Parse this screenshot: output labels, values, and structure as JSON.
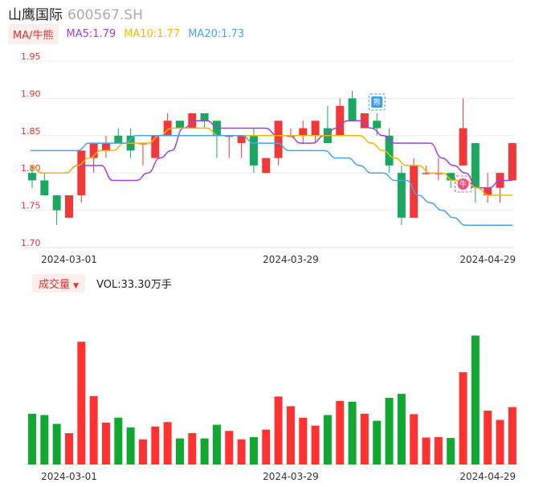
{
  "header": {
    "name": "山鹰国际",
    "code": "600567.SH"
  },
  "ma_legend": {
    "chip": "MA/牛熊",
    "items": [
      {
        "label": "MA5:1.79",
        "color": "#a040e0"
      },
      {
        "label": "MA10:1.77",
        "color": "#f2b800"
      },
      {
        "label": "MA20:1.73",
        "color": "#4aa3ea"
      }
    ]
  },
  "vol_legend": {
    "chip": "成交量",
    "label": "VOL:33.30万手"
  },
  "markers": {
    "bear": "熊",
    "bull": "牛"
  },
  "colors": {
    "up": "#f03838",
    "down": "#1aa860",
    "vol_up": "#ff3232",
    "vol_down": "#10a830",
    "ma5": "#a040e0",
    "ma10": "#f2b800",
    "ma20": "#4aa3ea"
  },
  "chart_data": [
    {
      "type": "candlestick",
      "y_ticks": [
        "1.95",
        "1.90",
        "1.85",
        "1.80",
        "1.75",
        "1.70"
      ],
      "ylim": [
        1.7,
        1.95
      ],
      "x_labels": [
        {
          "index": 0,
          "label": "2024-03-01"
        },
        {
          "index": 18,
          "label": "2024-03-29"
        },
        {
          "index": 34,
          "label": "2024-04-29"
        }
      ],
      "candles": [
        {
          "o": 1.8,
          "h": 1.81,
          "l": 1.78,
          "c": 1.79
        },
        {
          "o": 1.79,
          "h": 1.8,
          "l": 1.77,
          "c": 1.77
        },
        {
          "o": 1.77,
          "h": 1.77,
          "l": 1.73,
          "c": 1.75
        },
        {
          "o": 1.74,
          "h": 1.77,
          "l": 1.74,
          "c": 1.77
        },
        {
          "o": 1.77,
          "h": 1.83,
          "l": 1.76,
          "c": 1.83
        },
        {
          "o": 1.82,
          "h": 1.84,
          "l": 1.8,
          "c": 1.84
        },
        {
          "o": 1.83,
          "h": 1.85,
          "l": 1.82,
          "c": 1.84
        },
        {
          "o": 1.85,
          "h": 1.86,
          "l": 1.84,
          "c": 1.84
        },
        {
          "o": 1.85,
          "h": 1.86,
          "l": 1.82,
          "c": 1.83
        },
        {
          "o": 1.84,
          "h": 1.84,
          "l": 1.81,
          "c": 1.84
        },
        {
          "o": 1.82,
          "h": 1.85,
          "l": 1.82,
          "c": 1.85
        },
        {
          "o": 1.85,
          "h": 1.88,
          "l": 1.85,
          "c": 1.87
        },
        {
          "o": 1.87,
          "h": 1.87,
          "l": 1.86,
          "c": 1.86
        },
        {
          "o": 1.86,
          "h": 1.88,
          "l": 1.86,
          "c": 1.88
        },
        {
          "o": 1.88,
          "h": 1.88,
          "l": 1.86,
          "c": 1.87
        },
        {
          "o": 1.87,
          "h": 1.87,
          "l": 1.82,
          "c": 1.85
        },
        {
          "o": 1.85,
          "h": 1.85,
          "l": 1.82,
          "c": 1.85
        },
        {
          "o": 1.84,
          "h": 1.85,
          "l": 1.82,
          "c": 1.85
        },
        {
          "o": 1.85,
          "h": 1.86,
          "l": 1.8,
          "c": 1.81
        },
        {
          "o": 1.8,
          "h": 1.82,
          "l": 1.8,
          "c": 1.82
        },
        {
          "o": 1.82,
          "h": 1.87,
          "l": 1.81,
          "c": 1.87
        },
        {
          "o": 1.85,
          "h": 1.86,
          "l": 1.85,
          "c": 1.85
        },
        {
          "o": 1.85,
          "h": 1.87,
          "l": 1.84,
          "c": 1.86
        },
        {
          "o": 1.85,
          "h": 1.87,
          "l": 1.84,
          "c": 1.87
        },
        {
          "o": 1.86,
          "h": 1.89,
          "l": 1.84,
          "c": 1.84
        },
        {
          "o": 1.85,
          "h": 1.9,
          "l": 1.85,
          "c": 1.89
        },
        {
          "o": 1.9,
          "h": 1.91,
          "l": 1.87,
          "c": 1.87
        },
        {
          "o": 1.86,
          "h": 1.88,
          "l": 1.86,
          "c": 1.88
        },
        {
          "o": 1.87,
          "h": 1.88,
          "l": 1.85,
          "c": 1.86
        },
        {
          "o": 1.85,
          "h": 1.86,
          "l": 1.8,
          "c": 1.81
        },
        {
          "o": 1.8,
          "h": 1.81,
          "l": 1.73,
          "c": 1.74
        },
        {
          "o": 1.74,
          "h": 1.82,
          "l": 1.74,
          "c": 1.81
        },
        {
          "o": 1.8,
          "h": 1.81,
          "l": 1.8,
          "c": 1.8
        },
        {
          "o": 1.8,
          "h": 1.82,
          "l": 1.79,
          "c": 1.8
        },
        {
          "o": 1.8,
          "h": 1.8,
          "l": 1.78,
          "c": 1.79
        },
        {
          "o": 1.81,
          "h": 1.9,
          "l": 1.81,
          "c": 1.86
        },
        {
          "o": 1.84,
          "h": 1.84,
          "l": 1.76,
          "c": 1.78
        },
        {
          "o": 1.77,
          "h": 1.8,
          "l": 1.76,
          "c": 1.78
        },
        {
          "o": 1.78,
          "h": 1.8,
          "l": 1.76,
          "c": 1.8
        },
        {
          "o": 1.79,
          "h": 1.84,
          "l": 1.79,
          "c": 1.84
        }
      ],
      "series": [
        {
          "name": "MA5",
          "values": [
            1.81,
            1.8,
            1.8,
            1.8,
            1.81,
            1.81,
            1.81,
            1.79,
            1.79,
            1.79,
            1.8,
            1.82,
            1.83,
            1.86,
            1.87,
            1.87,
            1.86,
            1.86,
            1.86,
            1.86,
            1.86,
            1.85,
            1.85,
            1.84,
            1.84,
            1.85,
            1.86,
            1.87,
            1.87,
            1.86,
            1.85,
            1.84,
            1.84,
            1.84,
            1.84,
            1.82,
            1.81,
            1.8,
            1.78,
            1.78,
            1.79,
            1.79
          ]
        },
        {
          "name": "MA10",
          "values": [
            1.81,
            1.8,
            1.8,
            1.8,
            1.81,
            1.82,
            1.83,
            1.83,
            1.84,
            1.84,
            1.84,
            1.85,
            1.86,
            1.86,
            1.86,
            1.86,
            1.85,
            1.85,
            1.85,
            1.85,
            1.85,
            1.85,
            1.85,
            1.85,
            1.85,
            1.85,
            1.85,
            1.85,
            1.85,
            1.84,
            1.83,
            1.82,
            1.81,
            1.81,
            1.8,
            1.8,
            1.79,
            1.79,
            1.78,
            1.77,
            1.77,
            1.77
          ]
        },
        {
          "name": "MA20",
          "values": [
            1.83,
            1.83,
            1.83,
            1.83,
            1.83,
            1.84,
            1.84,
            1.84,
            1.84,
            1.85,
            1.85,
            1.85,
            1.85,
            1.85,
            1.85,
            1.85,
            1.85,
            1.85,
            1.85,
            1.84,
            1.84,
            1.84,
            1.83,
            1.83,
            1.83,
            1.83,
            1.82,
            1.82,
            1.81,
            1.8,
            1.8,
            1.79,
            1.79,
            1.77,
            1.76,
            1.75,
            1.74,
            1.73,
            1.73,
            1.73,
            1.73,
            1.73
          ]
        }
      ]
    },
    {
      "type": "bar",
      "name": "VOL",
      "x_labels": [
        {
          "index": 0,
          "label": "2024-03-01"
        },
        {
          "index": 18,
          "label": "2024-03-29"
        },
        {
          "index": 34,
          "label": "2024-04-29"
        }
      ],
      "values": [
        11.5,
        11.2,
        9.2,
        7.1,
        27.8,
        15.5,
        9.5,
        10.6,
        8.4,
        5.7,
        8.6,
        9.6,
        5.9,
        7.1,
        5.9,
        9.0,
        7.6,
        5.7,
        6.2,
        7.9,
        15.4,
        13.2,
        10.6,
        8.8,
        11.2,
        14.4,
        14.2,
        11.5,
        9.9,
        15.1,
        16.0,
        11.4,
        6.1,
        6.2,
        6.0,
        20.9,
        29.2,
        12.2,
        10.1,
        13.0
      ],
      "ylim": [
        0,
        33.3
      ]
    }
  ]
}
